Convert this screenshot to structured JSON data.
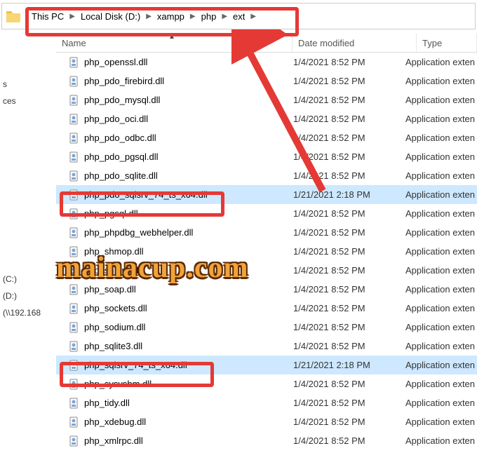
{
  "breadcrumb": {
    "items": [
      {
        "label": "This PC"
      },
      {
        "label": "Local Disk (D:)"
      },
      {
        "label": "xampp"
      },
      {
        "label": "php"
      },
      {
        "label": "ext"
      }
    ]
  },
  "columns": {
    "name": "Name",
    "date": "Date modified",
    "type": "Type"
  },
  "nav_fragments": [
    "s",
    "ces",
    "",
    "",
    "",
    "(C:)",
    "(D:)",
    "(\\\\192.168"
  ],
  "files": [
    {
      "name": "php_openssl.dll",
      "date": "1/4/2021 8:52 PM",
      "type": "Application exten",
      "sel": false
    },
    {
      "name": "php_pdo_firebird.dll",
      "date": "1/4/2021 8:52 PM",
      "type": "Application exten",
      "sel": false
    },
    {
      "name": "php_pdo_mysql.dll",
      "date": "1/4/2021 8:52 PM",
      "type": "Application exten",
      "sel": false
    },
    {
      "name": "php_pdo_oci.dll",
      "date": "1/4/2021 8:52 PM",
      "type": "Application exten",
      "sel": false
    },
    {
      "name": "php_pdo_odbc.dll",
      "date": "1/4/2021 8:52 PM",
      "type": "Application exten",
      "sel": false
    },
    {
      "name": "php_pdo_pgsql.dll",
      "date": "1/4/2021 8:52 PM",
      "type": "Application exten",
      "sel": false
    },
    {
      "name": "php_pdo_sqlite.dll",
      "date": "1/4/2021 8:52 PM",
      "type": "Application exten",
      "sel": false
    },
    {
      "name": "php_pdo_sqlsrv_74_ts_x64.dll",
      "date": "1/21/2021 2:18 PM",
      "type": "Application exten",
      "sel": true
    },
    {
      "name": "php_pgsql.dll",
      "date": "1/4/2021 8:52 PM",
      "type": "Application exten",
      "sel": false
    },
    {
      "name": "php_phpdbg_webhelper.dll",
      "date": "1/4/2021 8:52 PM",
      "type": "Application exten",
      "sel": false
    },
    {
      "name": "php_shmop.dll",
      "date": "1/4/2021 8:52 PM",
      "type": "Application exten",
      "sel": false
    },
    {
      "name": "php_snmp.dll",
      "date": "1/4/2021 8:52 PM",
      "type": "Application exten",
      "sel": false
    },
    {
      "name": "php_soap.dll",
      "date": "1/4/2021 8:52 PM",
      "type": "Application exten",
      "sel": false
    },
    {
      "name": "php_sockets.dll",
      "date": "1/4/2021 8:52 PM",
      "type": "Application exten",
      "sel": false
    },
    {
      "name": "php_sodium.dll",
      "date": "1/4/2021 8:52 PM",
      "type": "Application exten",
      "sel": false
    },
    {
      "name": "php_sqlite3.dll",
      "date": "1/4/2021 8:52 PM",
      "type": "Application exten",
      "sel": false
    },
    {
      "name": "php_sqlsrv_74_ts_x64.dll",
      "date": "1/21/2021 2:18 PM",
      "type": "Application exten",
      "sel": true
    },
    {
      "name": "php_sysvshm.dll",
      "date": "1/4/2021 8:52 PM",
      "type": "Application exten",
      "sel": false
    },
    {
      "name": "php_tidy.dll",
      "date": "1/4/2021 8:52 PM",
      "type": "Application exten",
      "sel": false
    },
    {
      "name": "php_xdebug.dll",
      "date": "1/4/2021 8:52 PM",
      "type": "Application exten",
      "sel": false
    },
    {
      "name": "php_xmlrpc.dll",
      "date": "1/4/2021 8:52 PM",
      "type": "Application exten",
      "sel": false
    }
  ],
  "watermark": "mainacup.com"
}
